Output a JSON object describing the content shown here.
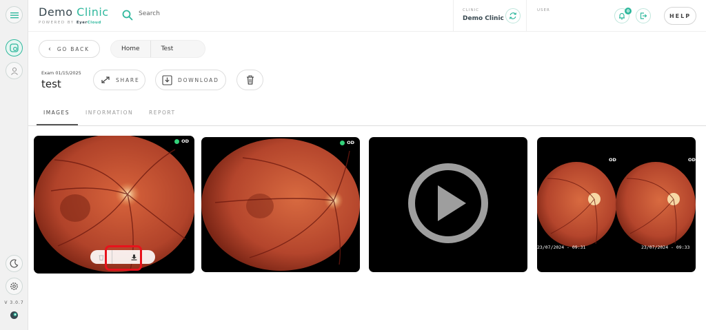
{
  "app": {
    "brand_name": "Demo",
    "brand_accent": "Clinic",
    "powered_by": "POWERED BY",
    "powered_brand": "Eyer",
    "powered_brand_accent": "Cloud"
  },
  "header": {
    "search_placeholder": "Search",
    "clinic_label": "CLINIC",
    "clinic_name": "Demo Clinic",
    "user_label": "USER",
    "notification_count": "0",
    "help_label": "HELP"
  },
  "sidebar": {
    "version": "V 3.0.7"
  },
  "toolbar": {
    "back_label": "GO BACK",
    "breadcrumb": [
      "Home",
      "Test"
    ],
    "share_label": "SHARE",
    "download_label": "DOWNLOAD"
  },
  "exam": {
    "date_label": "Exam 01/15/2025",
    "title": "test"
  },
  "tabs": [
    {
      "label": "IMAGES",
      "active": true
    },
    {
      "label": "INFORMATION",
      "active": false
    },
    {
      "label": "REPORT",
      "active": false
    }
  ],
  "images": [
    {
      "type": "fundus",
      "eye_label": "OD"
    },
    {
      "type": "fundus",
      "eye_label": "OD"
    },
    {
      "type": "video"
    },
    {
      "type": "stereo",
      "eye_labels": [
        "OD",
        "OD"
      ],
      "timestamps": [
        "23/07/2024 - 09:31",
        "23/07/2024 - 09:33"
      ]
    }
  ],
  "colors": {
    "accent": "#2fb89d",
    "highlight": "#e8121c",
    "status_dot": "#33d17a"
  }
}
